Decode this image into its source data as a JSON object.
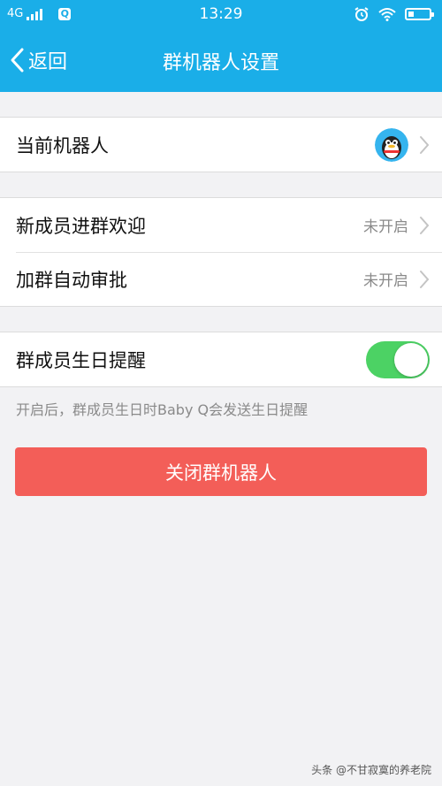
{
  "status_bar": {
    "network": "4G",
    "time": "13:29"
  },
  "nav": {
    "back_label": "返回",
    "title": "群机器人设置"
  },
  "sections": {
    "robot": {
      "label": "当前机器人"
    },
    "welcome": {
      "label": "新成员进群欢迎",
      "value": "未开启"
    },
    "approval": {
      "label": "加群自动审批",
      "value": "未开启"
    },
    "birthday": {
      "label": "群成员生日提醒",
      "enabled": true,
      "hint": "开启后，群成员生日时Baby Q会发送生日提醒"
    }
  },
  "close_button": {
    "label": "关闭群机器人"
  },
  "watermark": {
    "text": "头条 @不甘寂寞的养老院"
  },
  "colors": {
    "header_bg": "#1aaee8",
    "toggle_on": "#4cd264",
    "danger_button": "#f35e58",
    "page_bg": "#f2f2f4",
    "secondary_text": "#8a8a8a"
  },
  "icons": {
    "back": "chevron-left-icon",
    "row_chevron": "chevron-right-icon",
    "robot_avatar": "penguin-avatar-icon",
    "alarm": "alarm-icon",
    "wifi": "wifi-icon",
    "battery": "battery-icon",
    "signal": "signal-icon"
  }
}
